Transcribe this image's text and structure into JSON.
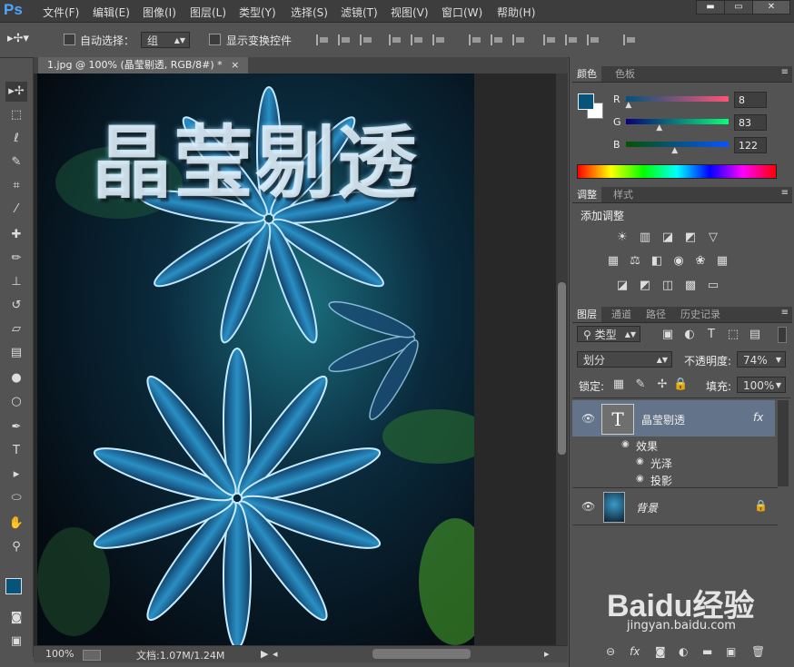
{
  "app": {
    "logo": "Ps"
  },
  "menu": [
    "文件(F)",
    "编辑(E)",
    "图像(I)",
    "图层(L)",
    "类型(Y)",
    "选择(S)",
    "滤镜(T)",
    "视图(V)",
    "窗口(W)",
    "帮助(H)"
  ],
  "options": {
    "auto_select_label": "自动选择：",
    "auto_select_value": "组",
    "show_transform_label": "显示变换控件"
  },
  "document": {
    "tab_title": "1.jpg @ 100% (晶莹剔透, RGB/8#) *",
    "close_glyph": "×",
    "canvas_text": "晶莹剔透",
    "zoom": "100%",
    "doc_size": "文档:1.07M/1.24M"
  },
  "color_panel": {
    "tabs": [
      "颜色",
      "色板"
    ],
    "channels": [
      {
        "label": "R",
        "value": "8",
        "level": 0.03
      },
      {
        "label": "G",
        "value": "83",
        "level": 0.33
      },
      {
        "label": "B",
        "value": "122",
        "level": 0.48
      }
    ],
    "foreground": "#085379"
  },
  "adjust_panel": {
    "tabs": [
      "调整",
      "样式"
    ],
    "add_label": "添加调整"
  },
  "layers_panel": {
    "tabs": [
      "图层",
      "通道",
      "路径",
      "历史记录"
    ],
    "filter_label": "类型",
    "blend_mode": "划分",
    "opacity_label": "不透明度:",
    "opacity_value": "74%",
    "lock_label": "锁定:",
    "fill_label": "填充:",
    "fill_value": "100%",
    "layers": [
      {
        "name": "晶莹剔透",
        "type": "text",
        "thumb": "T",
        "fx": "fx"
      },
      {
        "name": "背景",
        "type": "image"
      }
    ],
    "effects_label": "效果",
    "effects": [
      "光泽",
      "投影"
    ]
  },
  "watermark": {
    "brand": "Baidu经验",
    "url": "jingyan.baidu.com"
  }
}
